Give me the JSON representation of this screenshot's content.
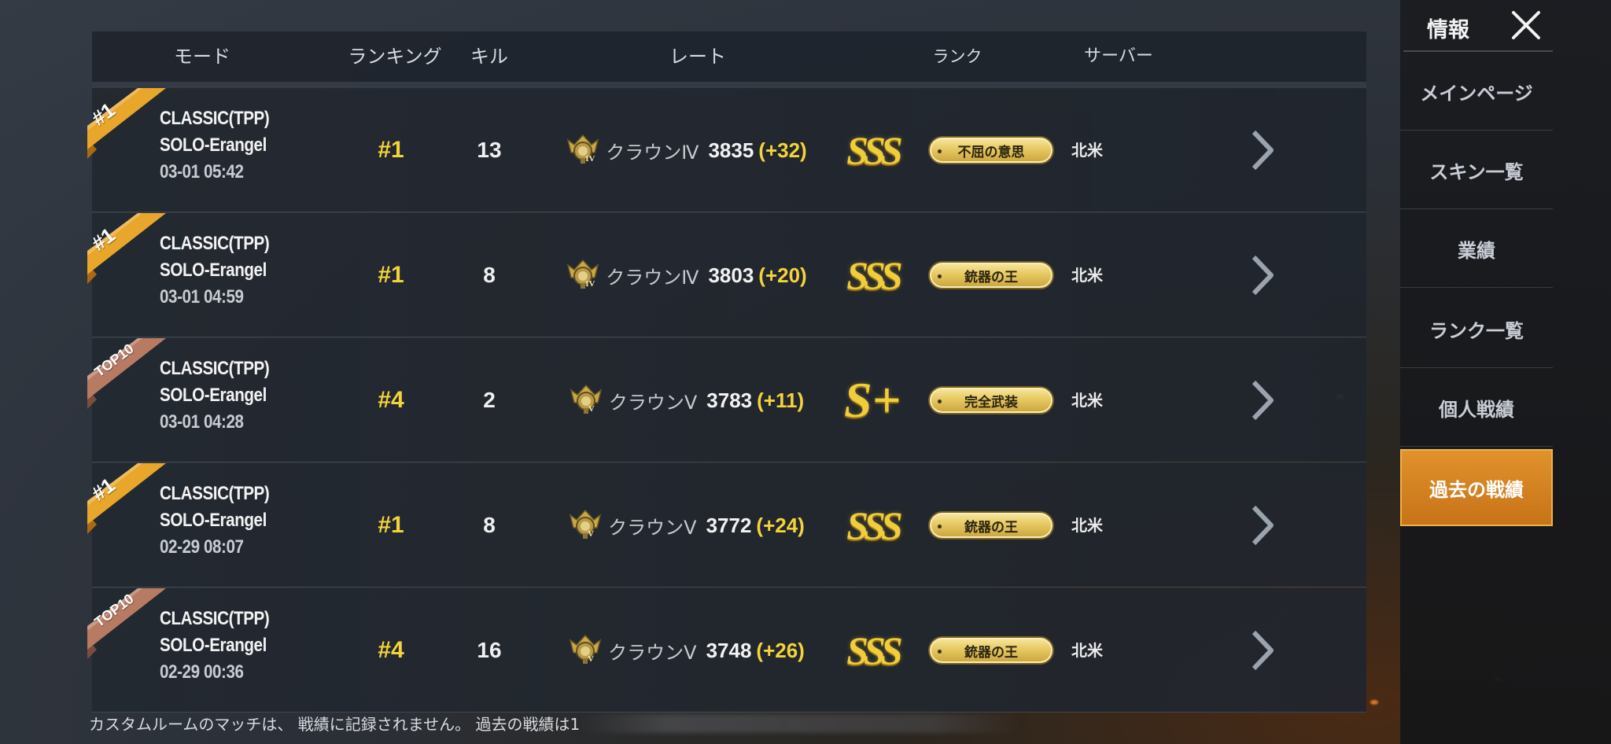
{
  "header": {
    "mode": "モード",
    "ranking": "ランキング",
    "kill": "キル",
    "rate": "レート",
    "rank": "ランク",
    "server": "サーバー"
  },
  "rows": [
    {
      "ribbon": "#1",
      "mode_line1": "CLASSIC(TPP)",
      "mode_line2": "SOLO-Erangel",
      "datetime": "03-01 05:42",
      "ranking": "#1",
      "kills": "13",
      "tier": "クラウンⅣ",
      "tier_numeral": "IV",
      "rate": "3835",
      "delta": "(+32)",
      "grade": "SSS",
      "title": "不屈の意思",
      "server": "北米"
    },
    {
      "ribbon": "#1",
      "mode_line1": "CLASSIC(TPP)",
      "mode_line2": "SOLO-Erangel",
      "datetime": "03-01 04:59",
      "ranking": "#1",
      "kills": "8",
      "tier": "クラウンⅣ",
      "tier_numeral": "IV",
      "rate": "3803",
      "delta": "(+20)",
      "grade": "SSS",
      "title": "銃器の王",
      "server": "北米"
    },
    {
      "ribbon": "TOP10",
      "mode_line1": "CLASSIC(TPP)",
      "mode_line2": "SOLO-Erangel",
      "datetime": "03-01 04:28",
      "ranking": "#4",
      "kills": "2",
      "tier": "クラウンⅤ",
      "tier_numeral": "V",
      "rate": "3783",
      "delta": "(+11)",
      "grade": "S+",
      "title": "完全武装",
      "server": "北米"
    },
    {
      "ribbon": "#1",
      "mode_line1": "CLASSIC(TPP)",
      "mode_line2": "SOLO-Erangel",
      "datetime": "02-29 08:07",
      "ranking": "#1",
      "kills": "8",
      "tier": "クラウンⅤ",
      "tier_numeral": "V",
      "rate": "3772",
      "delta": "(+24)",
      "grade": "SSS",
      "title": "銃器の王",
      "server": "北米"
    },
    {
      "ribbon": "TOP10",
      "mode_line1": "CLASSIC(TPP)",
      "mode_line2": "SOLO-Erangel",
      "datetime": "02-29 00:36",
      "ranking": "#4",
      "kills": "16",
      "tier": "クラウンⅤ",
      "tier_numeral": "V",
      "rate": "3748",
      "delta": "(+26)",
      "grade": "SSS",
      "title": "銃器の王",
      "server": "北米"
    }
  ],
  "footer": {
    "note": "カスタムルームのマッチは、 戦績に記録されません。 過去の戦績は1"
  },
  "sidebar": {
    "title": "情報",
    "items": [
      {
        "label": "メインページ"
      },
      {
        "label": "スキン一覧"
      },
      {
        "label": "業績"
      },
      {
        "label": "ランク一覧"
      },
      {
        "label": "個人戦績"
      },
      {
        "label": "過去の戦績"
      }
    ]
  },
  "colors": {
    "accent_gold": "#f4d33a",
    "ribbon_gold": "#e8a62a",
    "ribbon_bronze": "#b77a62",
    "active_tab": "#d9852a"
  }
}
